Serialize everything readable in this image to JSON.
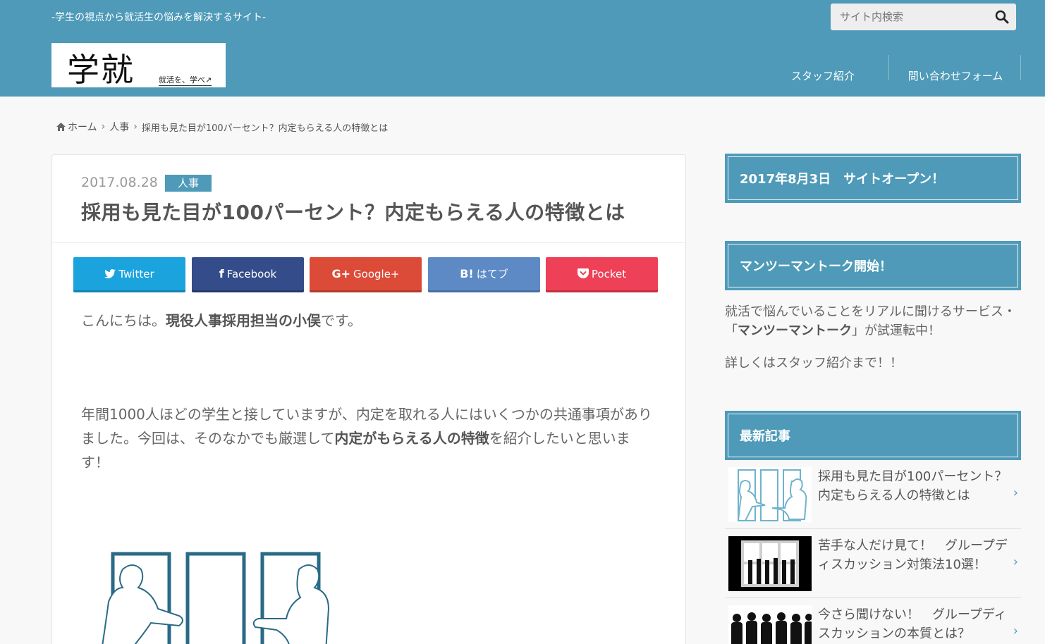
{
  "header": {
    "tagline": "-学生の視点から就活生の悩みを解決するサイト-",
    "logo_main": "学就",
    "logo_sub": "就活を、学べ↗",
    "search_placeholder": "サイト内検索",
    "nav": [
      {
        "label": "スタッフ紹介"
      },
      {
        "label": "問い合わせフォーム"
      }
    ],
    "colors": {
      "brand": "#4e9ab8"
    }
  },
  "breadcrumb": {
    "home": "ホーム",
    "category": "人事",
    "current": "採用も見た目が100パーセント？内定もらえる人の特徴とは"
  },
  "article": {
    "date": "2017.08.28",
    "category": "人事",
    "title": "採用も見た目が100パーセント？内定もらえる人の特徴とは",
    "share": [
      {
        "label": "Twitter",
        "icon": "twitter-icon",
        "color": "#1aa3dd"
      },
      {
        "label": "Facebook",
        "icon": "facebook-icon",
        "color": "#344d8a"
      },
      {
        "label": "Google+",
        "icon": "google-plus-icon",
        "color": "#dc4a38"
      },
      {
        "label": "はてブ",
        "icon": "hatena-icon",
        "color": "#5d8ac5"
      },
      {
        "label": "Pocket",
        "icon": "pocket-icon",
        "color": "#ee4056"
      }
    ],
    "p1_a": "こんにちは。",
    "p1_b": "現役人事採用担当の小俣",
    "p1_c": "です。",
    "p2_a": "年間1000人ほどの学生と接していますが、内定を取れる人にはいくつかの共通事項がありました。今回は、そのなかでも厳選して",
    "p2_b": "内定がもらえる人の特徴",
    "p2_c": "を紹介したいと思います！"
  },
  "sidebar": {
    "box1_title": "2017年8月3日　サイトオープン！",
    "box2_title": "マンツーマントーク開始！",
    "box2_text_a": "就活で悩んでいることをリアルに聞けるサービス・「",
    "box2_text_b": "マンツーマントーク",
    "box2_text_c": "」が試運転中！",
    "box2_text2": "詳しくはスタッフ紹介まで！！",
    "recent_title": "最新記事",
    "posts": [
      {
        "title": "採用も見た目が100パーセント？内定もらえる人の特徴とは"
      },
      {
        "title": "苦手な人だけ見て！　グループディスカッション対策法10選！"
      },
      {
        "title": "今さら聞けない！　グループディスカッションの本質とは？"
      }
    ]
  }
}
